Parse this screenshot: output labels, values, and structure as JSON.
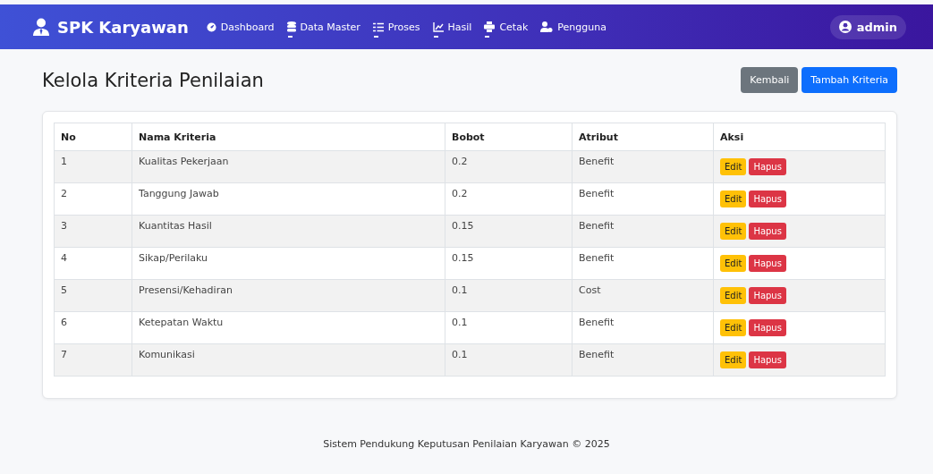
{
  "navbar": {
    "brand": "SPK Karyawan",
    "items": [
      {
        "label": "Dashboard",
        "dropdown": false
      },
      {
        "label": "Data Master",
        "dropdown": true
      },
      {
        "label": "Proses",
        "dropdown": true
      },
      {
        "label": "Hasil",
        "dropdown": true
      },
      {
        "label": "Cetak",
        "dropdown": true
      },
      {
        "label": "Pengguna",
        "dropdown": false
      }
    ],
    "user": "admin"
  },
  "page": {
    "title": "Kelola Kriteria Penilaian",
    "buttons": [
      {
        "label": "Kembali",
        "kind": "secondary"
      },
      {
        "label": "Tambah Kriteria",
        "kind": "primary"
      }
    ]
  },
  "table": {
    "columns": [
      "No",
      "Nama Kriteria",
      "Bobot",
      "Atribut",
      "Aksi"
    ],
    "rows": [
      {
        "no": "1",
        "nama": "Kualitas Pekerjaan",
        "bobot": "0.2",
        "atribut": "Benefit",
        "actions": [
          "Edit",
          "Hapus"
        ]
      },
      {
        "no": "2",
        "nama": "Tanggung Jawab",
        "bobot": "0.2",
        "atribut": "Benefit",
        "actions": [
          "Edit",
          "Hapus"
        ]
      },
      {
        "no": "3",
        "nama": "Kuantitas Hasil",
        "bobot": "0.15",
        "atribut": "Benefit",
        "actions": [
          "Edit",
          "Hapus"
        ]
      },
      {
        "no": "4",
        "nama": "Sikap/Perilaku",
        "bobot": "0.15",
        "atribut": "Benefit",
        "actions": [
          "Edit",
          "Hapus"
        ]
      },
      {
        "no": "5",
        "nama": "Presensi/Kehadiran",
        "bobot": "0.1",
        "atribut": "Cost",
        "actions": [
          "Edit",
          "Hapus"
        ]
      },
      {
        "no": "6",
        "nama": "Ketepatan Waktu",
        "bobot": "0.1",
        "atribut": "Benefit",
        "actions": [
          "Edit",
          "Hapus"
        ]
      },
      {
        "no": "7",
        "nama": "Komunikasi",
        "bobot": "0.1",
        "atribut": "Benefit",
        "actions": [
          "Edit",
          "Hapus"
        ]
      }
    ]
  },
  "footer": "Sistem Pendukung Keputusan Penilaian Karyawan © 2025"
}
